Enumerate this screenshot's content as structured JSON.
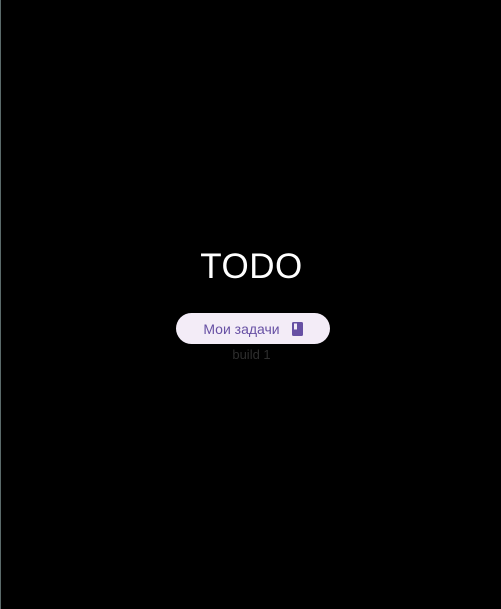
{
  "app": {
    "title": "TODO",
    "build": "build 1"
  },
  "main": {
    "tasks_button_label": "Мои задачи",
    "tasks_button_icon": "book-icon"
  },
  "colors": {
    "background": "#000000",
    "title_text": "#ffffff",
    "button_bg": "#f3ecf7",
    "button_text": "#6750a4",
    "build_text": "#2e2e2e"
  }
}
